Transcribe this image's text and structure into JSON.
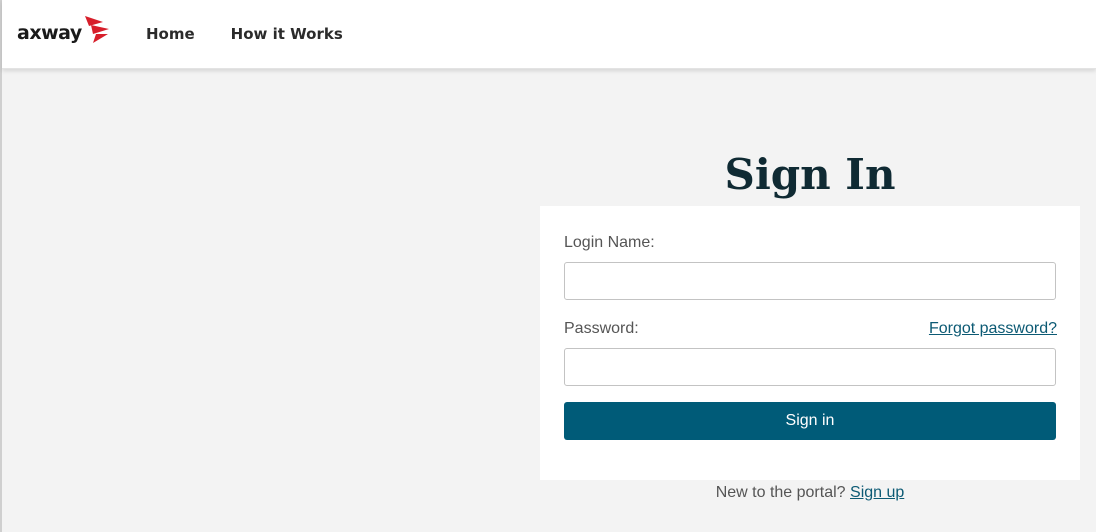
{
  "brand": {
    "name": "axway",
    "accent_color": "#d71f2b",
    "mark_icon": "chevron-stack-icon"
  },
  "nav": {
    "items": [
      {
        "label": "Home"
      },
      {
        "label": "How it Works"
      }
    ]
  },
  "signin": {
    "title": "Sign In",
    "login_name_label": "Login Name:",
    "login_name_value": "",
    "password_label": "Password:",
    "password_value": "",
    "forgot_label": "Forgot password?",
    "submit_label": "Sign in",
    "new_prompt": "New to the portal?",
    "signup_label": "Sign up"
  },
  "colors": {
    "primary": "#005b78",
    "link": "#0c5a74",
    "background": "#f3f3f3",
    "title": "#0f2a33"
  }
}
